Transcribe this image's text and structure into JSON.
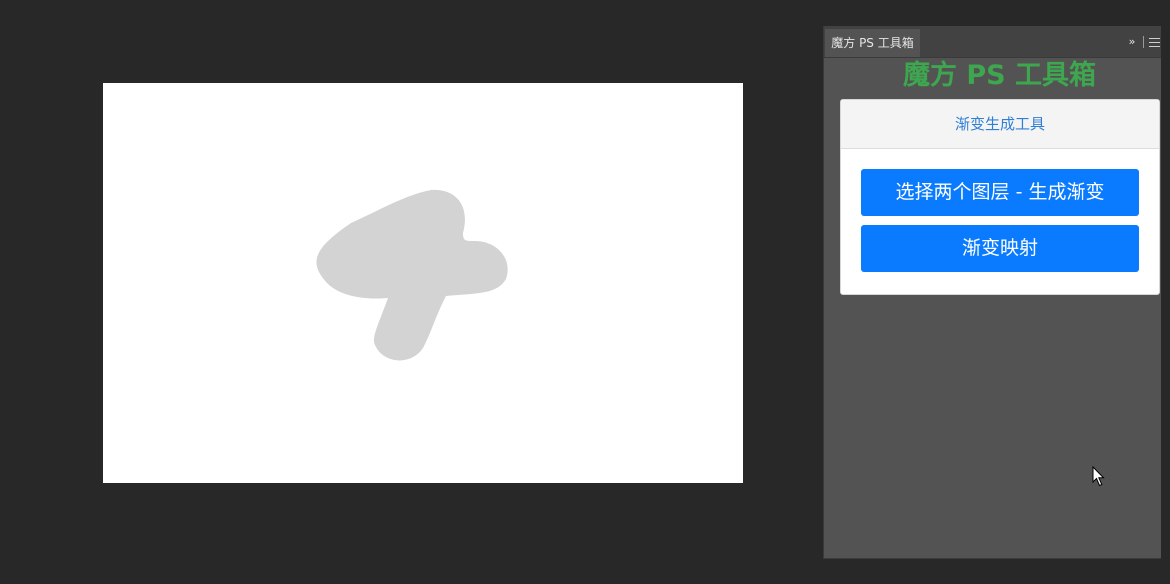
{
  "panel": {
    "tab_label": "魔方 PS 工具箱",
    "title": "魔方 PS 工具箱",
    "collapse_glyph": "››",
    "title_color": "#3ea64f"
  },
  "card": {
    "header": "渐变生成工具",
    "header_color": "#2f7fd4",
    "buttons": [
      {
        "label": "选择两个图层 - 生成渐变"
      },
      {
        "label": "渐变映射"
      }
    ],
    "button_color": "#0a7bff"
  },
  "canvas": {
    "background": "#ffffff",
    "shape_color": "#d3d3d3"
  },
  "icons": [
    "collapse-icon",
    "menu-icon",
    "mouse-cursor-icon"
  ]
}
